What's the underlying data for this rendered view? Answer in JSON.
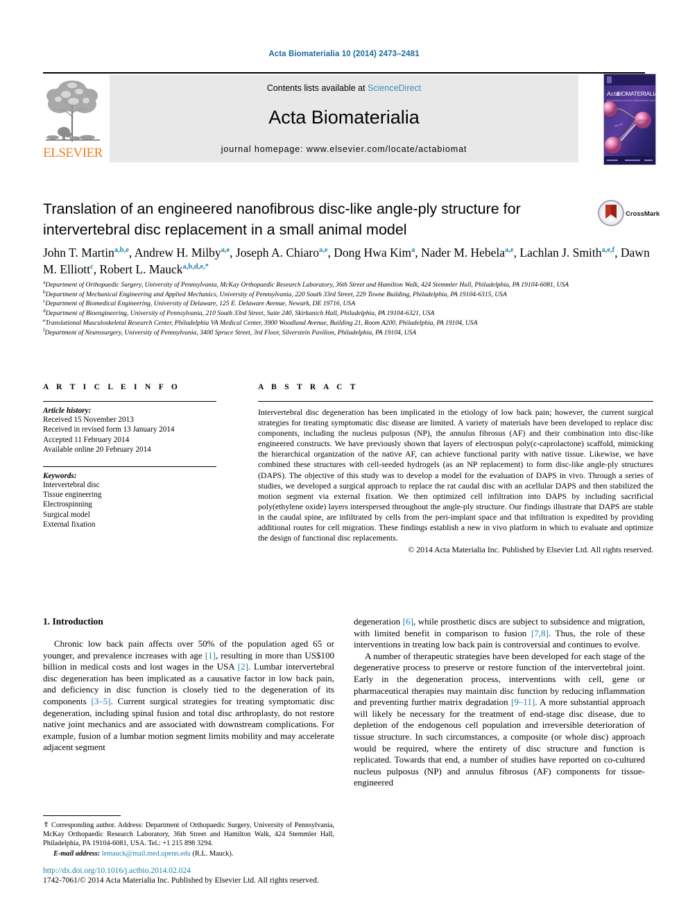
{
  "running_head": "Acta Biomaterialia 10 (2014) 2473–2481",
  "masthead": {
    "publisher_logo_label": "ELSEVIER",
    "contents_prefix": "Contents lists available at ",
    "contents_link": "ScienceDirect",
    "journal_title": "Acta Biomaterialia",
    "homepage": "journal homepage: www.elsevier.com/locate/actabiomat",
    "cover_title": "Acta BIOMATERIALIA",
    "cover_subtitle": "An International Journal of Biomaterials Science"
  },
  "article": {
    "title": "Translation of an engineered nanofibrous disc-like angle-ply structure for intervertebral disc replacement in a small animal model",
    "crossmark_label": "CrossMark",
    "authors": [
      {
        "name": "John T. Martin",
        "affil": "a,b,e",
        "sep": ", "
      },
      {
        "name": "Andrew H. Milby",
        "affil": "a,e",
        "sep": ", "
      },
      {
        "name": "Joseph A. Chiaro",
        "affil": "a,e",
        "sep": ", "
      },
      {
        "name": "Dong Hwa Kim",
        "affil": "a",
        "sep": ", "
      },
      {
        "name": "Nader M. Hebela",
        "affil": "a,e",
        "sep": ", "
      },
      {
        "name": "Lachlan J. Smith",
        "affil": "a,e,f",
        "sep": ", "
      },
      {
        "name": "Dawn M. Elliott",
        "affil": "c",
        "sep": ", "
      },
      {
        "name": "Robert L. Mauck",
        "affil": "a,b,d,e,*",
        "sep": ""
      }
    ],
    "affiliations": [
      {
        "mark": "a",
        "text": "Department of Orthopaedic Surgery, University of Pennsylvania, McKay Orthopaedic Research Laboratory, 36th Street and Hamilton Walk, 424 Stemmler Hall, Philadelphia, PA 19104-6081, USA"
      },
      {
        "mark": "b",
        "text": "Department of Mechanical Engineering and Applied Mechanics, University of Pennsylvania, 220 South 33rd Street, 229 Towne Building, Philadelphia, PA 19104-6315, USA"
      },
      {
        "mark": "c",
        "text": "Department of Biomedical Engineering, University of Delaware, 125 E. Delaware Avenue, Newark, DE 19716, USA"
      },
      {
        "mark": "d",
        "text": "Department of Bioengineering, University of Pennsylvania, 210 South 33rd Street, Suite 240, Skirkanich Hall, Philadelphia, PA 19104-6321, USA"
      },
      {
        "mark": "e",
        "text": "Translational Musculoskeletal Research Center, Philadelphia VA Medical Center, 3900 Woodland Avenue, Building 21, Room A200, Philadelphia, PA 19104, USA"
      },
      {
        "mark": "f",
        "text": "Department of Neurosurgery, University of Pennsylvania, 3400 Spruce Street, 3rd Floor, Silverstein Pavilion, Philadelphia, PA 19104, USA"
      }
    ]
  },
  "article_info": {
    "heading": "A R T I C L E    I N F O",
    "history_label": "Article history:",
    "history": [
      "Received 15 November 2013",
      "Received in revised form 13 January 2014",
      "Accepted 11 February 2014",
      "Available online 20 February 2014"
    ],
    "keywords_label": "Keywords:",
    "keywords": [
      "Intervertebral disc",
      "Tissue engineering",
      "Electrospinning",
      "Surgical model",
      "External fixation"
    ]
  },
  "abstract": {
    "heading": "A B S T R A C T",
    "text": "Intervertebral disc degeneration has been implicated in the etiology of low back pain; however, the current surgical strategies for treating symptomatic disc disease are limited. A variety of materials have been developed to replace disc components, including the nucleus pulposus (NP), the annulus fibrosus (AF) and their combination into disc-like engineered constructs. We have previously shown that layers of electrospun poly(ε-caprolactone) scaffold, mimicking the hierarchical organization of the native AF, can achieve functional parity with native tissue. Likewise, we have combined these structures with cell-seeded hydrogels (as an NP replacement) to form disc-like angle-ply structures (DAPS). The objective of this study was to develop a model for the evaluation of DAPS in vivo. Through a series of studies, we developed a surgical approach to replace the rat caudal disc with an acellular DAPS and then stabilized the motion segment via external fixation. We then optimized cell infiltration into DAPS by including sacrificial poly(ethylene oxide) layers interspersed throughout the angle-ply structure. Our findings illustrate that DAPS are stable in the caudal spine, are infiltrated by cells from the peri-implant space and that infiltration is expedited by providing additional routes for cell migration. These findings establish a new in vivo platform in which to evaluate and optimize the design of functional disc replacements.",
    "copyright": "© 2014 Acta Materialia Inc. Published by Elsevier Ltd. All rights reserved."
  },
  "introduction": {
    "heading": "1. Introduction",
    "left_paragraph_1_a": "Chronic low back pain affects over 50% of the population aged 65 or younger, and prevalence increases with age ",
    "left_ref_1": "[1]",
    "left_paragraph_1_b": ", resulting in more than US$100 billion in medical costs and lost wages in the USA ",
    "left_ref_2": "[2]",
    "left_paragraph_1_c": ". Lumbar intervertebral disc degeneration has been implicated as a causative factor in low back pain, and deficiency in disc function is closely tied to the degeneration of its components ",
    "left_ref_3": "[3–5]",
    "left_paragraph_1_d": ". Current surgical strategies for treating symptomatic disc degeneration, including spinal fusion and total disc arthroplasty, do not restore native joint mechanics and are associated with downstream complications. For example, fusion of a lumbar motion segment limits mobility and may accelerate adjacent segment",
    "right_paragraph_1_a": "degeneration ",
    "right_ref_1": "[6]",
    "right_paragraph_1_b": ", while prosthetic discs are subject to subsidence and migration, with limited benefit in comparison to fusion ",
    "right_ref_2": "[7,8]",
    "right_paragraph_1_c": ". Thus, the role of these interventions in treating low back pain is controversial and continues to evolve.",
    "right_paragraph_2_a": "A number of therapeutic strategies have been developed for each stage of the degenerative process to preserve or restore function of the intervertebral joint. Early in the degeneration process, interventions with cell, gene or pharmaceutical therapies may maintain disc function by reducing inflammation and preventing further matrix degradation ",
    "right_ref_3": "[9–11]",
    "right_paragraph_2_b": ". A more substantial approach will likely be necessary for the treatment of end-stage disc disease, due to depletion of the endogenous cell population and irreversible deterioration of tissue structure. In such circumstances, a composite (or whole disc) approach would be required, where the entirety of disc structure and function is replicated. Towards that end, a number of studies have reported on co-cultured nucleus pulposus (NP) and annulus fibrosus (AF) components for tissue-engineered"
  },
  "footnote": {
    "marker": "⇑",
    "text": " Corresponding author. Address: Department of Orthopaedic Surgery, University of Pennsylvania, McKay Orthopaedic Research Laboratory, 36th Street and Hamilton Walk, 424 Stemmler Hall, Philadelphia, PA 19104-6081, USA. Tel.: +1 215 898 3294.",
    "email_label": "E-mail address:",
    "email": "lemauck@mail.med.upenn.edu",
    "email_owner": "(R.L. Mauck)."
  },
  "footer": {
    "doi": "http://dx.doi.org/10.1016/j.actbio.2014.02.024",
    "issn_line": "1742-7061/© 2014 Acta Materialia Inc. Published by Elsevier Ltd. All rights reserved."
  },
  "colors": {
    "link_blue": "#1a7fa8",
    "header_blue": "#1a6a9c",
    "elsevier_orange": "#ef7d22",
    "banner_gray": "#e8e8e8"
  }
}
